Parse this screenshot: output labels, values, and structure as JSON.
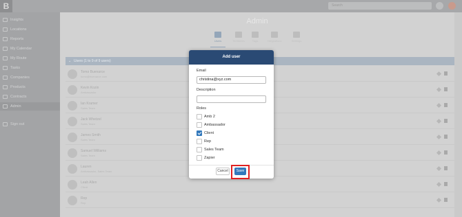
{
  "app": {
    "logo_letter": "B",
    "search_placeholder": "Search"
  },
  "sidebar": {
    "items": [
      {
        "label": "Insights",
        "icon": "chart-icon"
      },
      {
        "label": "Locations",
        "icon": "location-icon"
      },
      {
        "label": "Reports",
        "icon": "report-icon"
      },
      {
        "label": "My Calendar",
        "icon": "calendar-icon"
      },
      {
        "label": "My Route",
        "icon": "route-icon"
      },
      {
        "label": "Tasks",
        "icon": "tasks-icon"
      },
      {
        "label": "Companies",
        "icon": "companies-icon"
      },
      {
        "label": "Products",
        "icon": "products-icon"
      },
      {
        "label": "Contracts",
        "icon": "contracts-icon"
      },
      {
        "label": "Admin",
        "icon": "gear-icon",
        "active": true
      },
      {
        "label": "Sign out",
        "icon": "signout-icon"
      }
    ]
  },
  "main": {
    "title": "Admin",
    "tabs": [
      "Users",
      "Territories",
      "Tags",
      "Integrations",
      "Settings"
    ],
    "list_header": "Users (1 to 9 of 9 users)",
    "rows": [
      {
        "name": "Tomo Buenarce",
        "sub": "tomo@buenarce.com"
      },
      {
        "name": "Kevin Kozin",
        "sub": "Ambassador"
      },
      {
        "name": "Ian Kramer",
        "sub": "Sales Team"
      },
      {
        "name": "Jack Whetzel",
        "sub": "Sales Team"
      },
      {
        "name": "James Smith",
        "sub": "Sales Team"
      },
      {
        "name": "Samuel Williams",
        "sub": "Sales Team"
      },
      {
        "name": "Lauren",
        "sub": "Ambassador, Sales Team"
      },
      {
        "name": "Leah Allen",
        "sub": "Client"
      },
      {
        "name": "Rep",
        "sub": "Rep"
      }
    ]
  },
  "modal": {
    "title": "Add user",
    "email_label": "Email",
    "email_value": "christina@xyz.com",
    "description_label": "Description",
    "description_value": "",
    "roles_label": "Roles",
    "roles": [
      {
        "label": "Amb 2",
        "checked": false
      },
      {
        "label": "Ambassador",
        "checked": false
      },
      {
        "label": "Client",
        "checked": true
      },
      {
        "label": "Rep",
        "checked": false
      },
      {
        "label": "Sales Team",
        "checked": false
      },
      {
        "label": "Zapier",
        "checked": false
      }
    ],
    "cancel_label": "Cancel",
    "save_label": "Save"
  },
  "colors": {
    "modal_header": "#2a4a74",
    "primary_button": "#3278bb",
    "highlight": "#e02020",
    "checkbox_checked": "#3278bb"
  }
}
